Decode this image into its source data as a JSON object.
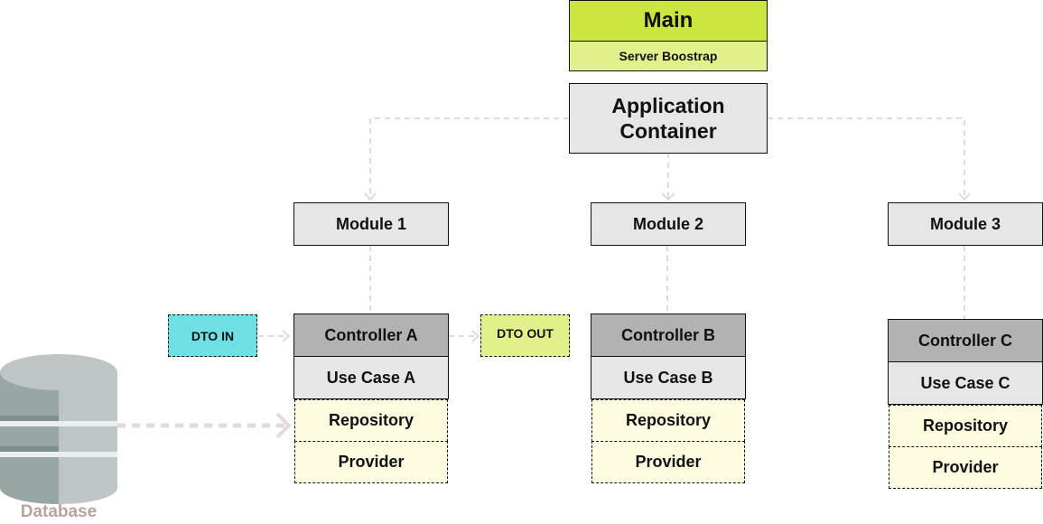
{
  "main": {
    "title": "Main",
    "subtitle": "Server Boostrap"
  },
  "container": {
    "line1": "Application",
    "line2": "Container"
  },
  "modules": [
    {
      "label": "Module 1",
      "controller": "Controller A",
      "use_case": "Use Case A",
      "repository": "Repository",
      "provider": "Provider"
    },
    {
      "label": "Module 2",
      "controller": "Controller B",
      "use_case": "Use Case B",
      "repository": "Repository",
      "provider": "Provider"
    },
    {
      "label": "Module 3",
      "controller": "Controller C",
      "use_case": "Use Case C",
      "repository": "Repository",
      "provider": "Provider"
    }
  ],
  "dto_in": "DTO IN",
  "dto_out": "DTO OUT",
  "database": "Database",
  "colors": {
    "main": "#cde63f",
    "bootstrap": "#e2f08c",
    "container": "#e6e6e6",
    "controller": "#b2b2b2",
    "use_case": "#e6e6e6",
    "repo": "#fefce0",
    "dto_in": "#6ee0e3",
    "dto_out": "#e2f08c",
    "connector": "#e4d8d8",
    "database_label": "#b9a3a1"
  }
}
